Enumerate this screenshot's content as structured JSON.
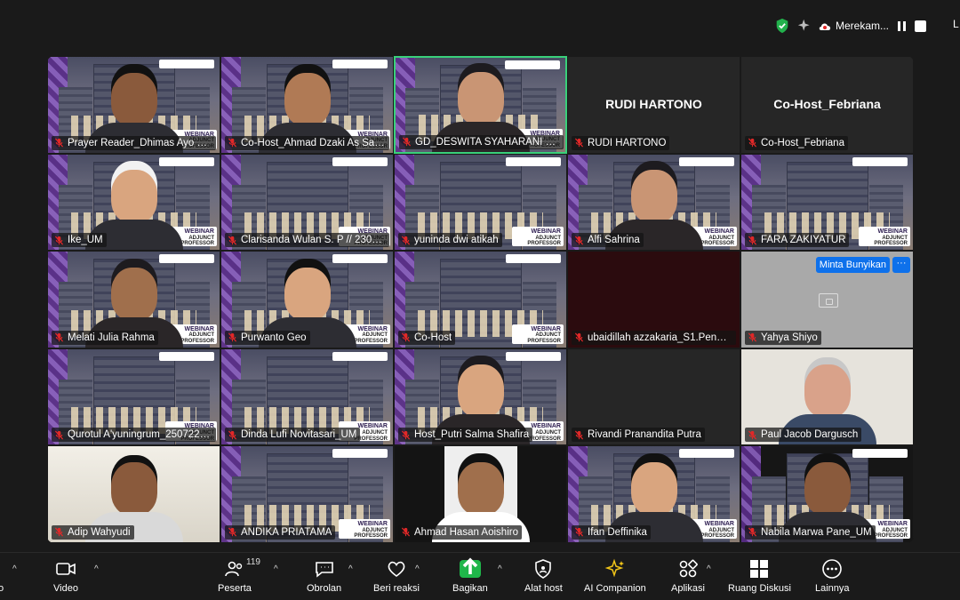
{
  "status": {
    "recording_label": "Merekam...",
    "right_clip": "L"
  },
  "tiles": [
    {
      "name": "Prayer Reader_Dhimas Ayo S.U"
    },
    {
      "name": "Co-Host_Ahmad Dzaki As Sajj..."
    },
    {
      "name": "GD_DESWITA SYAHARANI JASMI..."
    },
    {
      "name": "RUDI HARTONO",
      "big": "RUDI HARTONO"
    },
    {
      "name": "Co-Host_Febriana",
      "big": "Co-Host_Febriana"
    },
    {
      "name": "Ike_UM"
    },
    {
      "name": "Clarisanda Wulan S. P // 2307..."
    },
    {
      "name": "yuninda dwi atikah"
    },
    {
      "name": "Alfi Sahrina"
    },
    {
      "name": "FARA ZAKIYATUR"
    },
    {
      "name": "Melati Julia Rahma"
    },
    {
      "name": "Purwanto Geo"
    },
    {
      "name": "Co-Host"
    },
    {
      "name": "ubaidillah azzakaria_S1.Pend...."
    },
    {
      "name": "Yahya Shiyo",
      "ring": "Minta Bunyikan",
      "more": "···"
    },
    {
      "name": "Qurotul A'yuningrum_2507226..."
    },
    {
      "name": "Dinda Lufi Novitasari_UM"
    },
    {
      "name": "Host_Putri Salma Shafira"
    },
    {
      "name": "Rivandi Pranandita Putra"
    },
    {
      "name": "Paul Jacob Dargusch"
    },
    {
      "name": "Adip Wahyudi"
    },
    {
      "name": "ANDIKA PRIATAMA"
    },
    {
      "name": "Ahmad Hasan Aoishiro"
    },
    {
      "name": "Ifan Deffinika"
    },
    {
      "name": "Nabila Marwa Pane_UM"
    }
  ],
  "banner": {
    "line1": "WEBINAR",
    "line2": "ADJUNCT PROFESSOR"
  },
  "toolbar": {
    "video": "Video",
    "participants": "Peserta",
    "participants_count": "119",
    "chat": "Obrolan",
    "react": "Beri reaksi",
    "share": "Bagikan",
    "host_tools": "Alat host",
    "ai": "AI Companion",
    "apps": "Aplikasi",
    "breakout": "Ruang Diskusi",
    "more": "Lainnya",
    "left_clip": "o",
    "caret": "^"
  },
  "colors": {
    "active_border": "#39d07a",
    "share_green": "#1fb64a",
    "ring_blue": "#0e71eb",
    "mute_red": "#e02828"
  }
}
